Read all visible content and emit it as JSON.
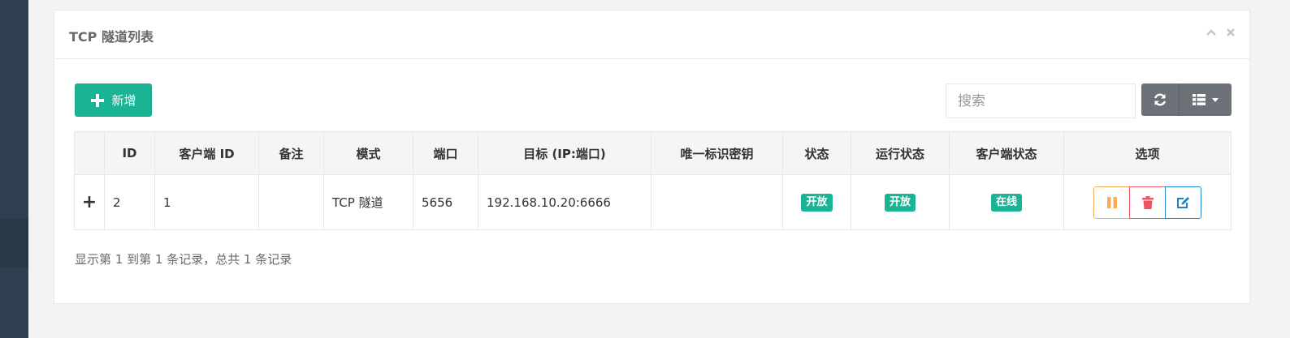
{
  "panel": {
    "title": "TCP 隧道列表"
  },
  "toolbar": {
    "add_label": "新增",
    "search_placeholder": "搜索"
  },
  "table": {
    "headers": [
      "ID",
      "客户端 ID",
      "备注",
      "模式",
      "端口",
      "目标 (IP:端口)",
      "唯一标识密钥",
      "状态",
      "运行状态",
      "客户端状态",
      "选项"
    ],
    "rows": [
      {
        "expand": "+",
        "id": "2",
        "client_id": "1",
        "remark": "",
        "mode": "TCP 隧道",
        "port": "5656",
        "target": "192.168.10.20:6666",
        "key": "",
        "status": "开放",
        "run_status": "开放",
        "client_status": "在线"
      }
    ]
  },
  "pagination": {
    "info": "显示第 1 到第 1 条记录，总共 1 条记录"
  },
  "colors": {
    "primary": "#1ab394",
    "warning": "#f8ac59",
    "danger": "#ed5565",
    "info": "#1c84c6",
    "sidebar": "#2f4050"
  },
  "icons": {
    "add": "plus-icon",
    "refresh": "refresh-icon",
    "columns": "list-icon",
    "collapse": "chevron-up-icon",
    "close": "close-icon",
    "pause": "pause-icon",
    "delete": "trash-icon",
    "edit": "edit-icon"
  }
}
